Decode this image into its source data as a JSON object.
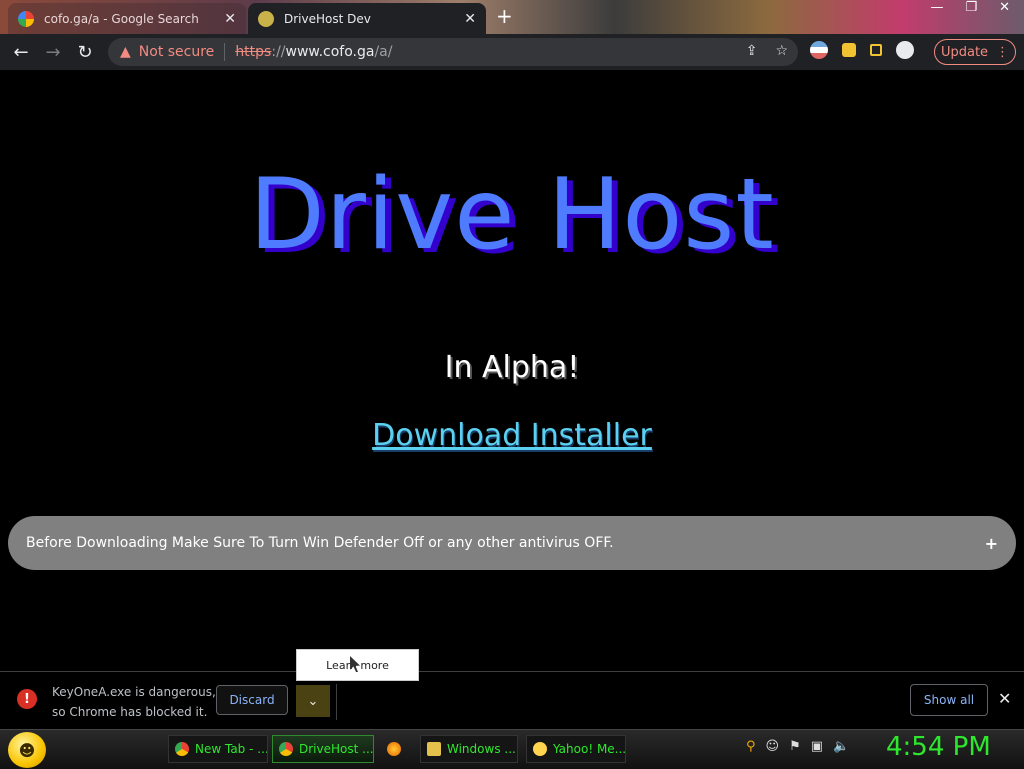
{
  "browser": {
    "tabs": [
      {
        "title": "cofo.ga/a - Google Search",
        "active": false
      },
      {
        "title": "DriveHost Dev",
        "active": true
      }
    ],
    "new_tab_symbol": "+",
    "security_label": "Not secure",
    "url": {
      "scheme": "https",
      "sep": "://",
      "host": "www.cofo.ga",
      "path": "/a/"
    },
    "update_label": "Update"
  },
  "page": {
    "title": "Drive Host",
    "subtitle": "In Alpha!",
    "download_link": "Download Installer",
    "notice": "Before Downloading Make Sure To Turn Win Defender Off or any other antivirus OFF.",
    "notice_toggle": "+"
  },
  "download_bar": {
    "menu_item": "Learn more",
    "message_line1": "KeyOneA.exe is dangerous,",
    "message_line2": "so Chrome has blocked it.",
    "discard_label": "Discard",
    "show_all_label": "Show all"
  },
  "taskbar": {
    "tasks": [
      {
        "label": "New Tab - ...",
        "icon": "chrome-icon"
      },
      {
        "label": "DriveHost ...",
        "icon": "chrome-icon"
      },
      {
        "label": "",
        "icon": "firefox-icon"
      },
      {
        "label": "Windows ...",
        "icon": "folder-icon"
      },
      {
        "label": "Yahoo! Me...",
        "icon": "yahoo-icon"
      }
    ],
    "clock": "4:54 PM"
  },
  "colors": {
    "hero_title": "#4f7cff",
    "hero_shadow": "#3300cc",
    "link": "#5ad1f0",
    "notice_bg": "#808080",
    "danger": "#d93025",
    "taskbar_text": "#2ee82e"
  }
}
